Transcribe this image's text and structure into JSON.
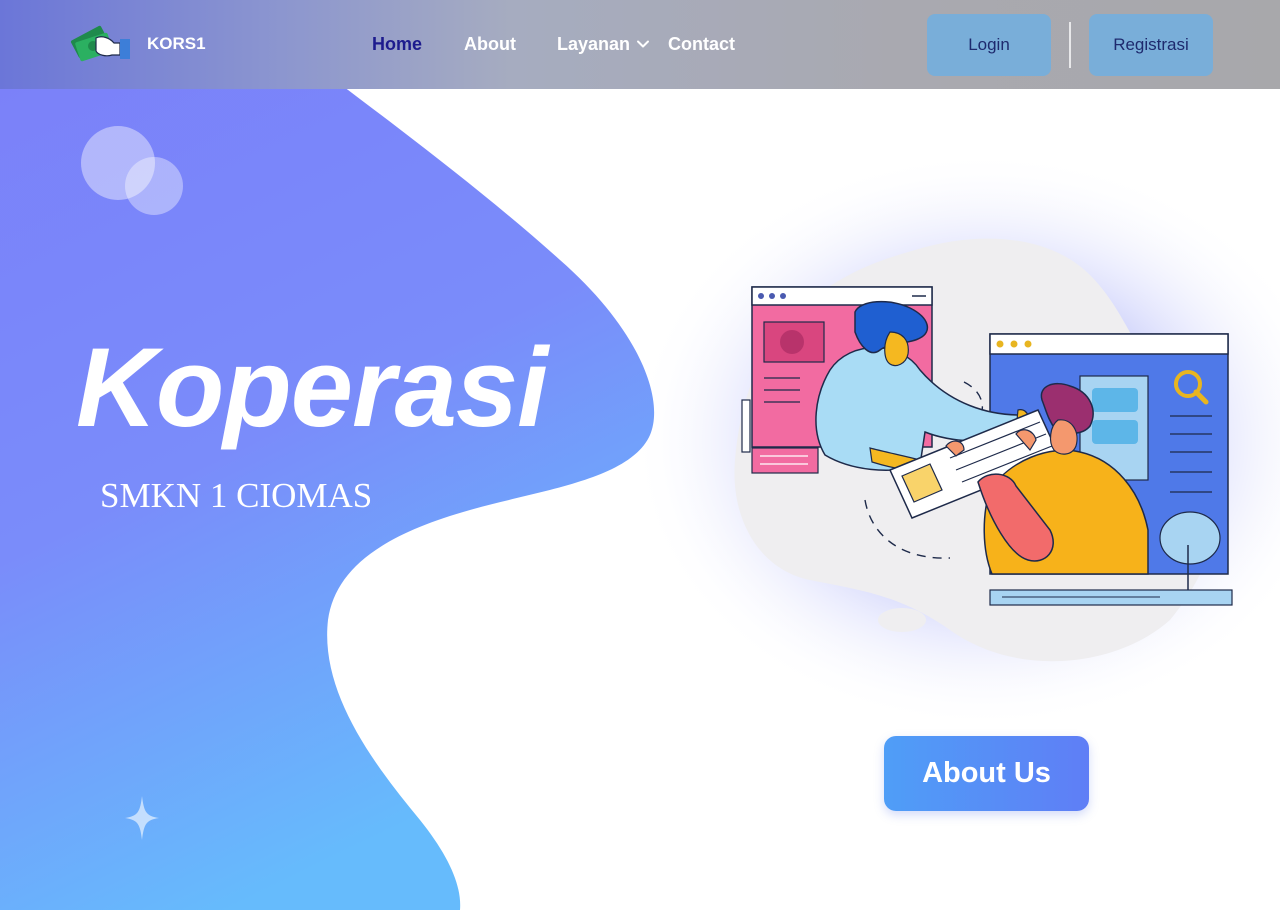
{
  "brand": {
    "name": "KORS1",
    "logo_icon": "money-hand-icon"
  },
  "nav": {
    "links": [
      {
        "label": "Home",
        "active": true
      },
      {
        "label": "About",
        "active": false
      },
      {
        "label": "Layanan",
        "active": false,
        "has_dropdown": true,
        "dropdown_icon": "chevron-down-icon"
      },
      {
        "label": "Contact",
        "active": false
      }
    ]
  },
  "auth": {
    "login_label": "Login",
    "register_label": "Registrasi"
  },
  "hero": {
    "title": "Koperasi",
    "subtitle": "SMKN 1 CIOMAS",
    "cta_label": "About Us"
  },
  "illustration": {
    "icon": "collaboration-illustration"
  },
  "colors": {
    "active_nav": "#1d1b8e",
    "auth_button_bg": "#79aed9",
    "auth_button_text": "#1e2a6e",
    "blob_gradient": [
      "#7b85f8",
      "#6ab7fb"
    ],
    "cta_gradient": [
      "#4f9ef7",
      "#5f7ef6"
    ]
  }
}
